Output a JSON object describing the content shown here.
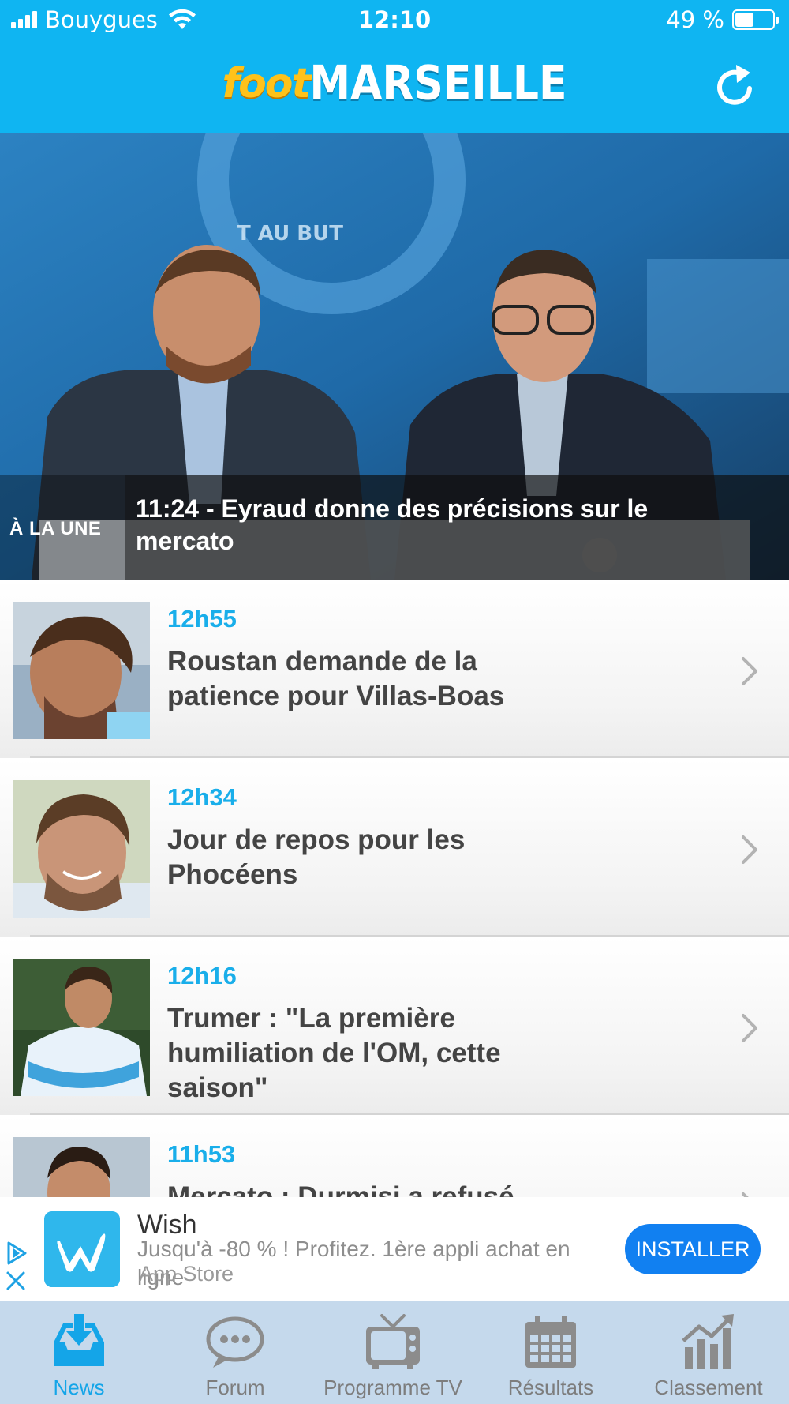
{
  "status_bar": {
    "carrier": "Bouygues",
    "time": "12:10",
    "battery_percent": "49 %",
    "battery_level": 0.49
  },
  "header": {
    "logo_part1": "foot",
    "logo_part2": "MARSEILLE",
    "refresh_icon": "refresh-icon"
  },
  "headline": {
    "tag": "À LA UNE",
    "title": "11:24 - Eyraud donne des précisions sur le mercato",
    "photo_text": "T AU BUT"
  },
  "news": [
    {
      "time": "12h55",
      "title": "Roustan demande de la patience pour Villas-Boas"
    },
    {
      "time": "12h34",
      "title": "Jour de repos pour les Phocéens"
    },
    {
      "time": "12h16",
      "title": "Trumer : \"La première humiliation de l'OM, cette saison\""
    },
    {
      "time": "11h53",
      "title": "Mercato : Durmisi a refusé"
    }
  ],
  "ad": {
    "name": "Wish",
    "description": "Jusqu'à -80 % ! Profitez. 1ère appli achat en ligne",
    "store": "App Store",
    "button": "INSTALLER"
  },
  "tabs": [
    {
      "label": "News",
      "icon": "download-tray-icon",
      "active": true
    },
    {
      "label": "Forum",
      "icon": "chat-bubble-icon",
      "active": false
    },
    {
      "label": "Programme TV",
      "icon": "tv-icon",
      "active": false
    },
    {
      "label": "Résultats",
      "icon": "calendar-icon",
      "active": false
    },
    {
      "label": "Classement",
      "icon": "bar-chart-icon",
      "active": false
    }
  ],
  "colors": {
    "brand_blue": "#0fb5f2",
    "time_blue": "#19aeea",
    "install_blue": "#1180f1",
    "tab_bar": "#c5d9ec"
  }
}
